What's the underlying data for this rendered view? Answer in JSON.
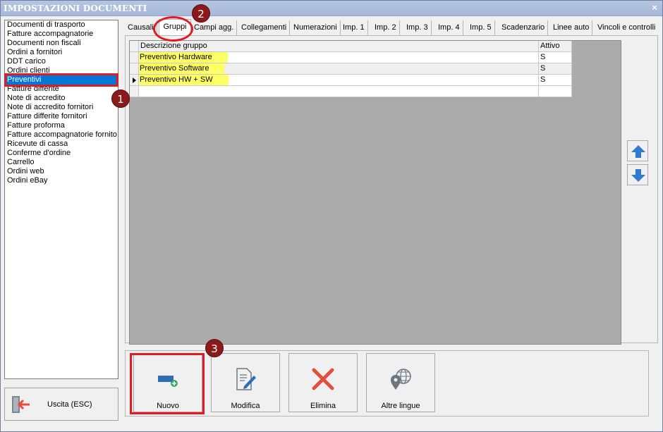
{
  "window": {
    "title": "IMPOSTAZIONI DOCUMENTI",
    "close_glyph": "×"
  },
  "doc_list": {
    "items": [
      "Documenti di trasporto",
      "Fatture accompagnatorie",
      "Documenti non fiscali",
      "Ordini a fornitori",
      "DDT carico",
      "Ordini clienti",
      "Preventivi",
      "Fatture differite",
      "Note di accredito",
      "Note di accredito fornitori",
      "Fatture differite fornitori",
      "Fatture proforma",
      "Fatture accompagnatorie fornito",
      "Ricevute di cassa",
      "Conferme d'ordine",
      "Carrello",
      "Ordini web",
      "Ordini eBay"
    ],
    "selected": "Preventivi"
  },
  "tabs": [
    "Causali",
    "Gruppi",
    "Campi agg.",
    "Collegamenti",
    "Numerazioni",
    "Imp. 1",
    "Imp. 2",
    "Imp. 3",
    "Imp. 4",
    "Imp. 5",
    "Scadenzario",
    "Linee auto",
    "Vincoli e controlli"
  ],
  "active_tab": "Gruppi",
  "grid": {
    "headers": {
      "description": "Descrizione gruppo",
      "active": "Attivo"
    },
    "rows": [
      {
        "description": "Preventivo Hardware",
        "active": "S"
      },
      {
        "description": "Preventivo Software",
        "active": "S"
      },
      {
        "description": "Preventivo HW + SW",
        "active": "S"
      }
    ]
  },
  "toolbar": {
    "new_label": "Nuovo",
    "edit_label": "Modifica",
    "delete_label": "Elimina",
    "languages_label": "Altre lingue"
  },
  "exit_label": "Uscita (ESC)",
  "annotations": {
    "badge1": "1",
    "badge2": "2",
    "badge3": "3"
  },
  "colors": {
    "accent_red": "#e01b24",
    "badge_bg": "#8b1a1a",
    "highlight_yellow": "#ffff66",
    "selection_blue": "#0078d7"
  },
  "icons": [
    "close-icon",
    "exit-door-icon",
    "arrow-up-icon",
    "arrow-down-icon",
    "new-item-icon",
    "edit-document-icon",
    "delete-x-icon",
    "globe-location-icon",
    "row-pointer-icon"
  ]
}
